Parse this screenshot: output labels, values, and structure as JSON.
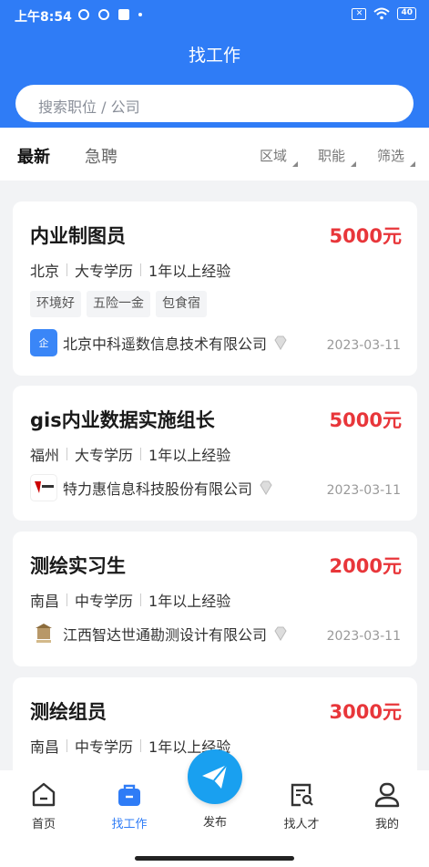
{
  "status_bar": {
    "time": "上午8:54",
    "battery": "40"
  },
  "header": {
    "title": "找工作"
  },
  "search": {
    "placeholder": "搜索职位 / 公司"
  },
  "tabs": [
    "最新",
    "急聘"
  ],
  "filters": [
    "区域",
    "职能",
    "筛选"
  ],
  "jobs": [
    {
      "title": "内业制图员",
      "salary": "5000元",
      "city": "北京",
      "education": "大专学历",
      "experience": "1年以上经验",
      "tags": [
        "环境好",
        "五险一金",
        "包食宿"
      ],
      "company": "北京中科遥数信息技术有限公司",
      "date": "2023-03-11",
      "logo_color": "#3a86f7"
    },
    {
      "title": "gis内业数据实施组长",
      "salary": "5000元",
      "city": "福州",
      "education": "大专学历",
      "experience": "1年以上经验",
      "tags": [],
      "company": "特力惠信息科技股份有限公司",
      "date": "2023-03-11",
      "logo_color": "#ffffff"
    },
    {
      "title": "测绘实习生",
      "salary": "2000元",
      "city": "南昌",
      "education": "中专学历",
      "experience": "1年以上经验",
      "tags": [],
      "company": "江西智达世通勘测设计有限公司",
      "date": "2023-03-11",
      "logo_color": "#ffffff"
    },
    {
      "title": "测绘组员",
      "salary": "3000元",
      "city": "南昌",
      "education": "中专学历",
      "experience": "1年以上经验",
      "tags": [],
      "company": "",
      "date": "",
      "logo_color": "#ffffff"
    }
  ],
  "bottom_nav": [
    {
      "label": "首页",
      "icon": "home-icon",
      "active": false
    },
    {
      "label": "找工作",
      "icon": "briefcase-icon",
      "active": true
    },
    {
      "label": "发布",
      "icon": "send-icon",
      "active": false
    },
    {
      "label": "找人才",
      "icon": "search-resume-icon",
      "active": false
    },
    {
      "label": "我的",
      "icon": "profile-icon",
      "active": false
    }
  ],
  "colors": {
    "primary": "#2f7cf6",
    "salary": "#e8363a",
    "fab": "#19a0f0"
  }
}
